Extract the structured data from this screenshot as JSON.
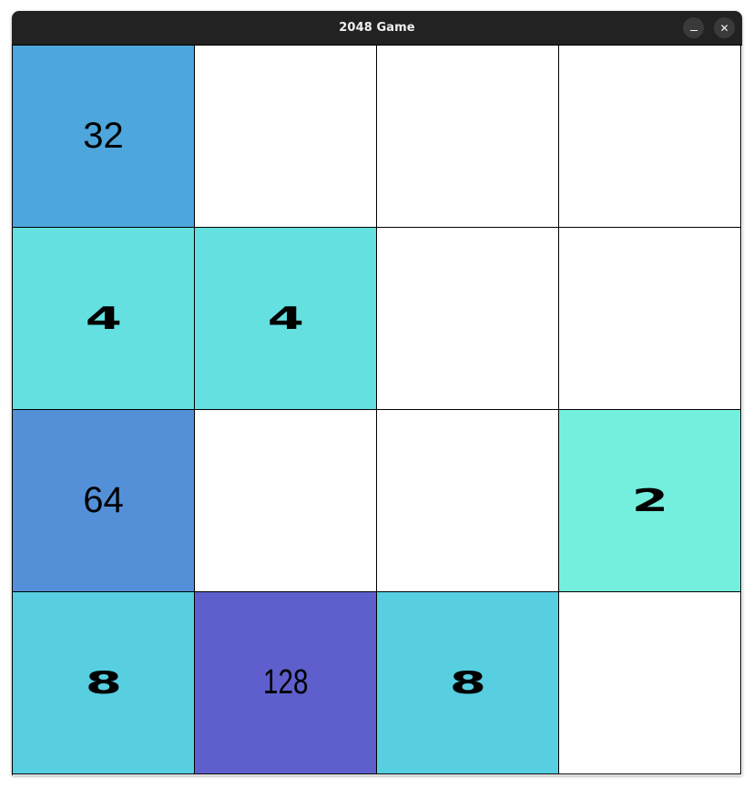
{
  "window": {
    "title": "2048 Game",
    "minimize_label": "–",
    "close_label": "✕"
  },
  "board": {
    "tiles": [
      [
        "32",
        "",
        "",
        ""
      ],
      [
        "4",
        "4",
        "",
        ""
      ],
      [
        "64",
        "",
        "",
        "2"
      ],
      [
        "8",
        "128",
        "8",
        ""
      ]
    ],
    "colors": {
      "empty": "#ffffff",
      "2": "#74efde",
      "4": "#64e0e0",
      "8": "#57cfe0",
      "32": "#4da6dc",
      "64": "#5490d8",
      "128": "#5e5fcc"
    }
  }
}
